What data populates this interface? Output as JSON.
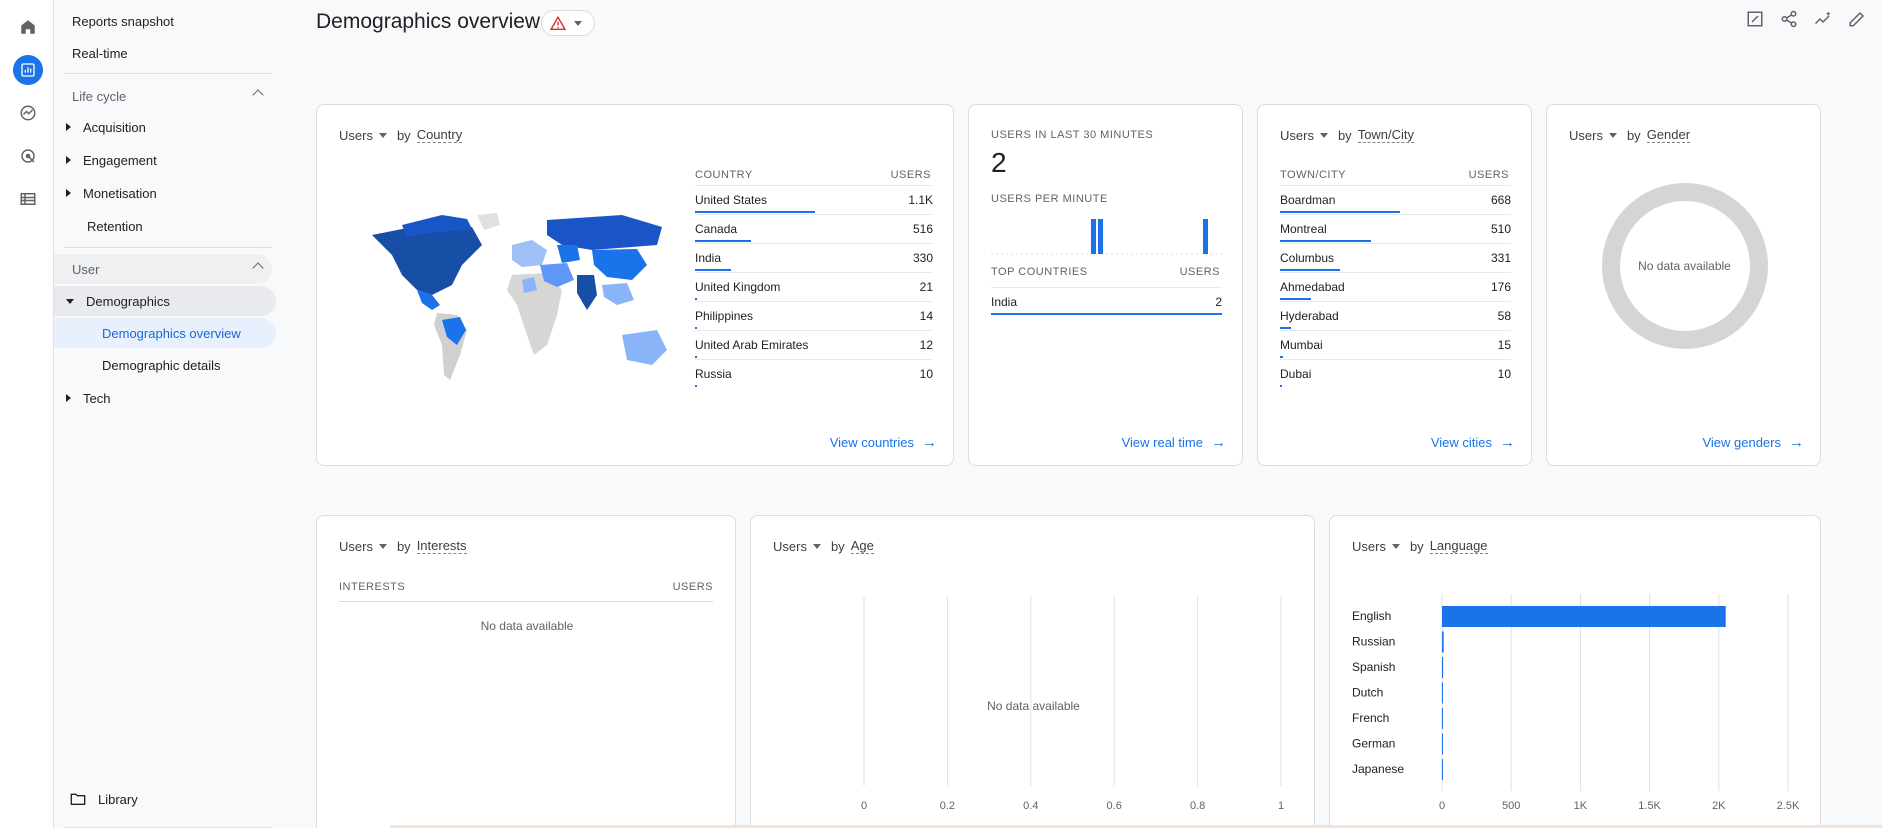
{
  "nav": {
    "top_items": [
      "Reports snapshot",
      "Real-time"
    ],
    "lifecycle": {
      "label": "Life cycle",
      "items": [
        "Acquisition",
        "Engagement",
        "Monetisation",
        "Retention"
      ]
    },
    "user": {
      "label": "User",
      "demographics": "Demographics",
      "sub": [
        "Demographics overview",
        "Demographic details"
      ],
      "tech": "Tech"
    },
    "library": "Library"
  },
  "header": {
    "title": "Demographics overview"
  },
  "common": {
    "metric": "Users",
    "by": "by",
    "users_col": "USERS",
    "no_data": "No data available"
  },
  "country_card": {
    "dimension": "Country",
    "col": "COUNTRY",
    "rows": [
      {
        "name": "United States",
        "value": "1.1K",
        "share": 1.0
      },
      {
        "name": "Canada",
        "value": "516",
        "share": 0.47
      },
      {
        "name": "India",
        "value": "330",
        "share": 0.3
      },
      {
        "name": "United Kingdom",
        "value": "21",
        "share": 0.02
      },
      {
        "name": "Philippines",
        "value": "14",
        "share": 0.013
      },
      {
        "name": "United Arab Emirates",
        "value": "12",
        "share": 0.011
      },
      {
        "name": "Russia",
        "value": "10",
        "share": 0.009
      }
    ],
    "link": "View countries"
  },
  "realtime_card": {
    "label": "USERS IN LAST 30 MINUTES",
    "count": "2",
    "per_minute": "USERS PER MINUTE",
    "top_countries": "TOP COUNTRIES",
    "rows": [
      {
        "name": "India",
        "value": "2",
        "share": 1.0
      }
    ],
    "link": "View real time"
  },
  "city_card": {
    "dimension": "Town/City",
    "col": "TOWN/CITY",
    "rows": [
      {
        "name": "Boardman",
        "value": "668",
        "share": 1.0
      },
      {
        "name": "Montreal",
        "value": "510",
        "share": 0.76
      },
      {
        "name": "Columbus",
        "value": "331",
        "share": 0.5
      },
      {
        "name": "Ahmedabad",
        "value": "176",
        "share": 0.26
      },
      {
        "name": "Hyderabad",
        "value": "58",
        "share": 0.09
      },
      {
        "name": "Mumbai",
        "value": "15",
        "share": 0.022
      },
      {
        "name": "Dubai",
        "value": "10",
        "share": 0.015
      }
    ],
    "link": "View cities"
  },
  "gender_card": {
    "dimension": "Gender",
    "link": "View genders"
  },
  "interests_card": {
    "dimension": "Interests",
    "col": "INTERESTS"
  },
  "age_card": {
    "dimension": "Age",
    "x_ticks": [
      "0",
      "0.2",
      "0.4",
      "0.6",
      "0.8",
      "1"
    ]
  },
  "language_card": {
    "dimension": "Language"
  },
  "chart_data": {
    "type": "bar",
    "orientation": "horizontal",
    "categories": [
      "English",
      "Russian",
      "Spanish",
      "Dutch",
      "French",
      "German",
      "Japanese"
    ],
    "values": [
      2050,
      12,
      8,
      3,
      2,
      2,
      1
    ],
    "xlim": [
      0,
      2500
    ],
    "x_ticks": [
      "0",
      "500",
      "1K",
      "1.5K",
      "2K",
      "2.5K"
    ],
    "grid": true,
    "color": "#1a73e8"
  }
}
